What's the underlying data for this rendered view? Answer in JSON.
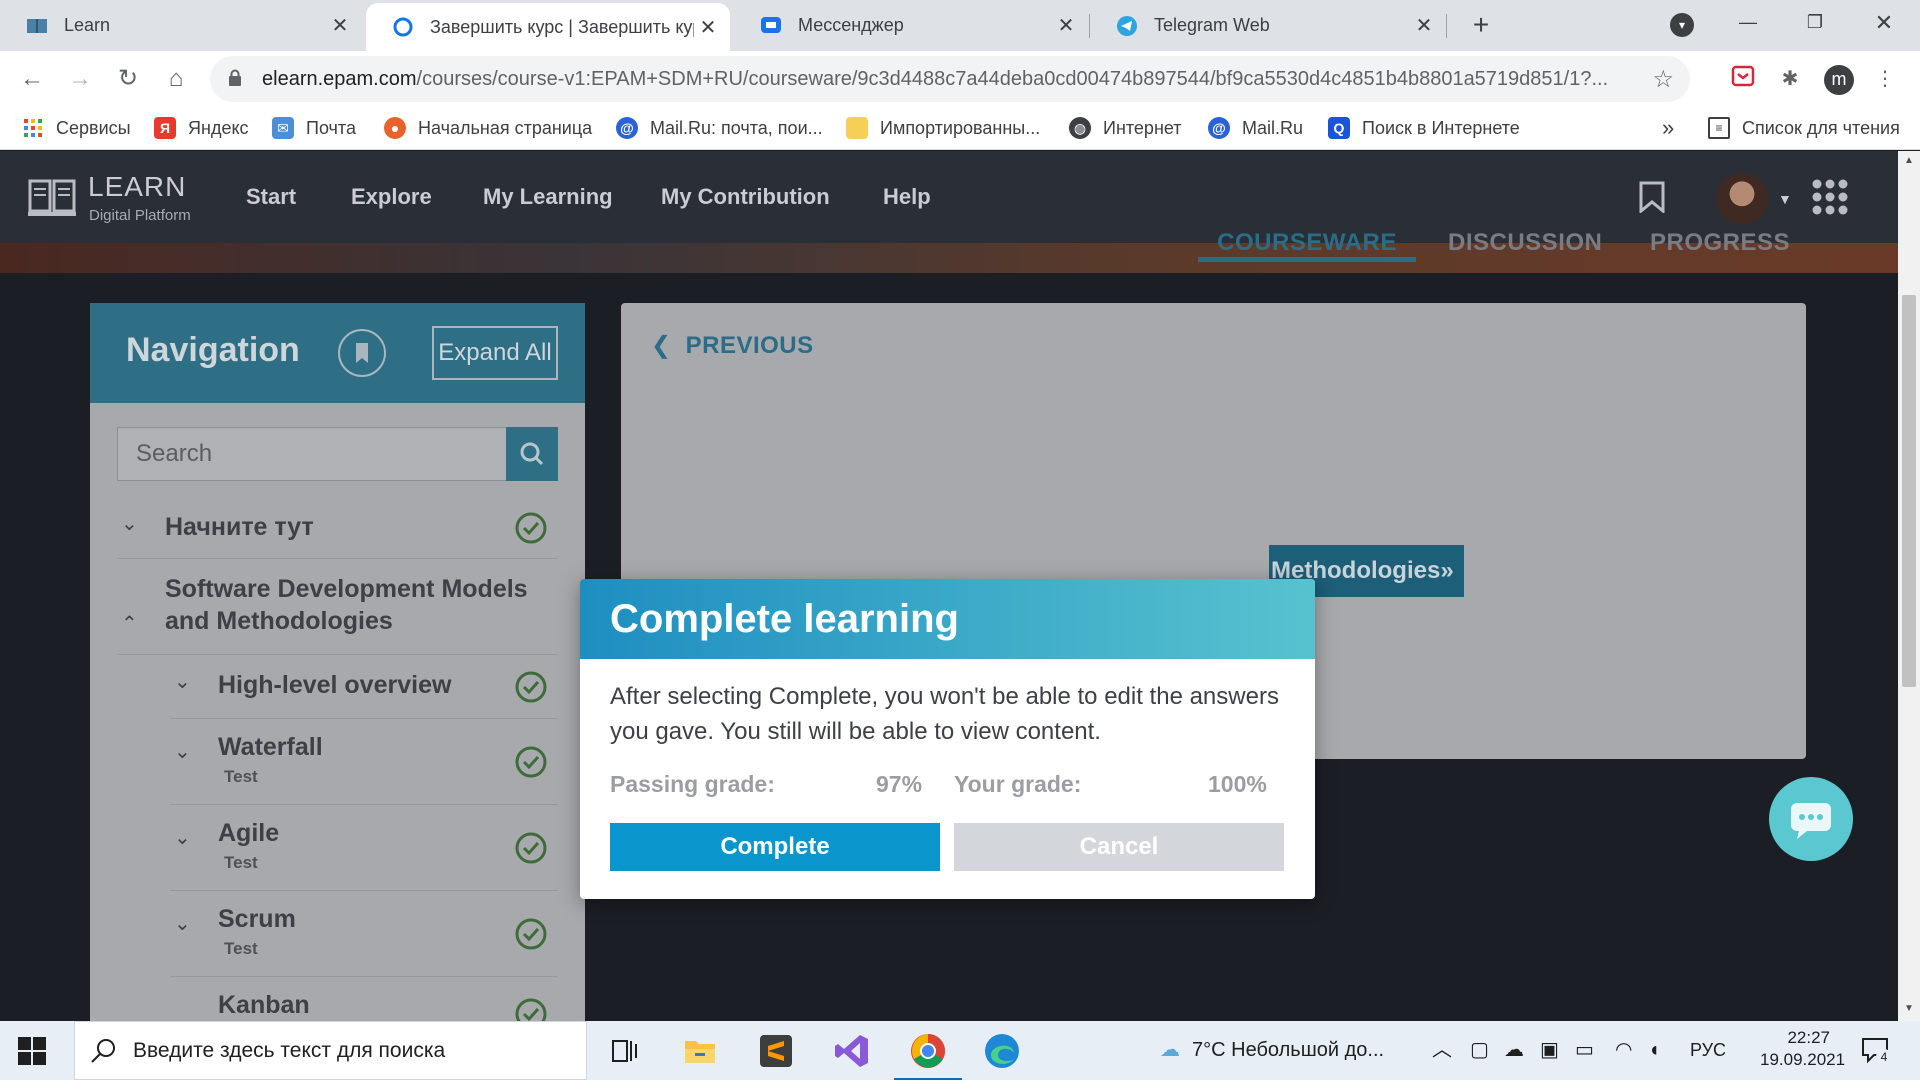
{
  "browser": {
    "tabs": [
      {
        "title": "Learn",
        "active": false
      },
      {
        "title": "Завершить курс | Завершить курс",
        "active": true
      },
      {
        "title": "Мессенджер",
        "active": false
      },
      {
        "title": "Telegram Web",
        "active": false
      }
    ],
    "close_glyph": "✕",
    "new_tab_glyph": "+",
    "url_host": "elearn.epam.com",
    "url_path": "/courses/course-v1:EPAM+SDM+RU/courseware/9c3d4488c7a44deba0cd00474b897544/bf9ca5530d4c4851b4b8801a5719d851/1?...",
    "profile_initial": "m",
    "bookmarks": [
      {
        "label": "Сервисы",
        "icon": "apps-grid-icon"
      },
      {
        "label": "Яндекс",
        "icon": "yandex-icon"
      },
      {
        "label": "Почта",
        "icon": "mail-icon"
      },
      {
        "label": "Начальная страница",
        "icon": "firefox-icon"
      },
      {
        "label": "Mail.Ru: почта, пои...",
        "icon": "mailru-icon"
      },
      {
        "label": "Импортированны...",
        "icon": "folder-icon"
      },
      {
        "label": "Интернет",
        "icon": "globe-icon"
      },
      {
        "label": "Mail.Ru",
        "icon": "mailru-icon"
      },
      {
        "label": "Поиск в Интернете",
        "icon": "search-icon"
      }
    ],
    "more_bookmarks": "»",
    "reading_list": "Список для чтения"
  },
  "site": {
    "logo_title": "LEARN",
    "logo_subtitle": "Digital Platform",
    "nav": [
      "Start",
      "Explore",
      "My Learning",
      "My Contribution",
      "Help"
    ],
    "subtabs": [
      "COURSEWARE",
      "DISCUSSION",
      "PROGRESS"
    ]
  },
  "navigation": {
    "title": "Navigation",
    "expand_all": "Expand All",
    "search_placeholder": "Search",
    "items": [
      {
        "label": "Начните тут",
        "sub": "",
        "chevron": "⌄"
      },
      {
        "label": "Software Development Models and Methodologies",
        "sub": "",
        "chevron": "⌃"
      },
      {
        "label": "High-level overview",
        "sub": "",
        "chevron": "⌄"
      },
      {
        "label": "Waterfall",
        "sub": "Test",
        "chevron": "⌄"
      },
      {
        "label": "Agile",
        "sub": "Test",
        "chevron": "⌄"
      },
      {
        "label": "Scrum",
        "sub": "Test",
        "chevron": "⌄"
      },
      {
        "label": "Kanban",
        "sub": "",
        "chevron": ""
      }
    ]
  },
  "content": {
    "previous": "PREVIOUS",
    "next_button_partial": "Methodologies»"
  },
  "modal": {
    "title": "Complete learning",
    "body": "After selecting Complete, you won't be able to edit the answers you gave. You still will be able to view content.",
    "passing_grade_label": "Passing grade:",
    "passing_grade_value": "97%",
    "your_grade_label": "Your grade:",
    "your_grade_value": "100%",
    "complete_label": "Complete",
    "cancel_label": "Cancel"
  },
  "taskbar": {
    "search_placeholder": "Введите здесь текст для поиска",
    "weather": "7°C  Небольшой до...",
    "language": "РУС",
    "time": "22:27",
    "date": "19.09.2021",
    "notification_count": "4"
  },
  "colors": {
    "accent": "#0a95cc",
    "header_teal": "#2e6f86",
    "check_green": "#3f6b3a"
  }
}
